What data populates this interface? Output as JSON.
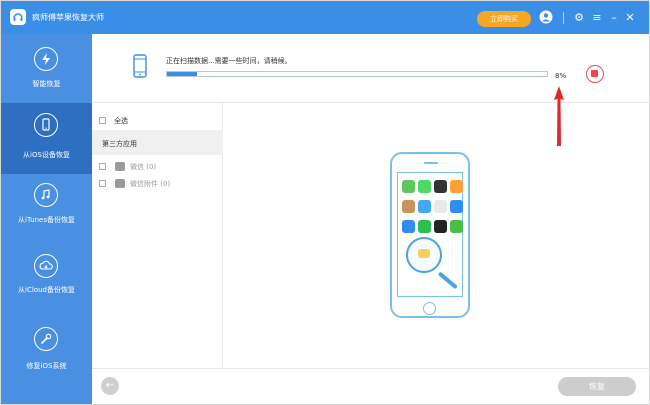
{
  "window": {
    "title": "疯师傅苹果恢复大师"
  },
  "titlebar": {
    "buy_label": "立即购买"
  },
  "sidebar": {
    "items": [
      {
        "label": "智能恢复",
        "icon": "smart-recover-icon"
      },
      {
        "label": "从iOS设备恢复",
        "icon": "ios-device-icon"
      },
      {
        "label": "从iTunes备份恢复",
        "icon": "itunes-icon"
      },
      {
        "label": "从iCloud备份恢复",
        "icon": "icloud-icon"
      },
      {
        "label": "修复iOS系统",
        "icon": "repair-icon"
      }
    ],
    "active_index": 1
  },
  "scan": {
    "status_text": "正在扫描数据...需要一些时间，请稍候。",
    "progress_percent": 8,
    "progress_label": "8%"
  },
  "tree": {
    "select_all": "全选",
    "group_title": "第三方应用",
    "items": [
      {
        "label": "微信 (0)"
      },
      {
        "label": "微信附件 (0)"
      }
    ]
  },
  "footer": {
    "recover_label": "恢复"
  },
  "colors": {
    "accent": "#3a8ee6",
    "sidebar": "#4a90e2",
    "sidebar_active": "#2f6fc2",
    "buy": "#f5a623",
    "stop": "#e94b4b"
  }
}
